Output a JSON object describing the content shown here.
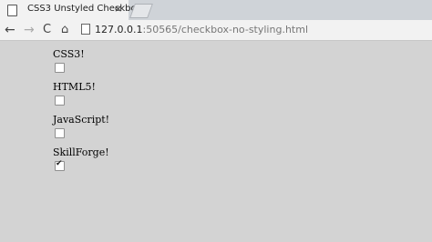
{
  "tab": {
    "title": "CSS3 Unstyled Checkbox",
    "close": "×"
  },
  "toolbar": {
    "back": "←",
    "forward": "→",
    "reload": "C",
    "home": "⌂",
    "url_host": "127.0.0.1",
    "url_rest": ":50565/checkbox-no-styling.html"
  },
  "icons": {
    "page": "page-icon",
    "back": "back-arrow-icon",
    "forward": "forward-arrow-icon",
    "reload": "reload-icon",
    "home": "home-icon"
  },
  "checkboxes": [
    {
      "label": "CSS3!",
      "checked": false
    },
    {
      "label": "HTML5!",
      "checked": false
    },
    {
      "label": "JavaScript!",
      "checked": false
    },
    {
      "label": "SkillForge!",
      "checked": true
    }
  ],
  "colors": {
    "page_background": "#d3d3d3",
    "tab_strip": "#cfd3d8"
  }
}
